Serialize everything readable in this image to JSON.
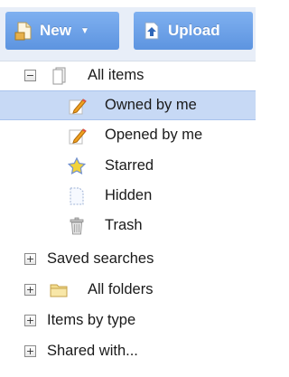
{
  "toolbar": {
    "new_label": "New",
    "upload_label": "Upload"
  },
  "tree": {
    "all_items": {
      "label": "All items",
      "icon": "document-stack-icon",
      "children": [
        {
          "label": "Owned by me",
          "icon": "pencil-document-icon",
          "selected": true
        },
        {
          "label": "Opened by me",
          "icon": "pencil-document-icon",
          "selected": false
        },
        {
          "label": "Starred",
          "icon": "star-icon",
          "selected": false
        },
        {
          "label": "Hidden",
          "icon": "hidden-document-icon",
          "selected": false
        },
        {
          "label": "Trash",
          "icon": "trash-icon",
          "selected": false
        }
      ]
    },
    "saved_searches": {
      "label": "Saved searches"
    },
    "all_folders": {
      "label": "All folders",
      "icon": "folder-icon"
    },
    "items_by_type": {
      "label": "Items by type"
    },
    "shared_with": {
      "label": "Shared with..."
    }
  },
  "colors": {
    "button": "#6a9fe8",
    "selection": "#c7d9f5",
    "star": "#f2d33a"
  }
}
